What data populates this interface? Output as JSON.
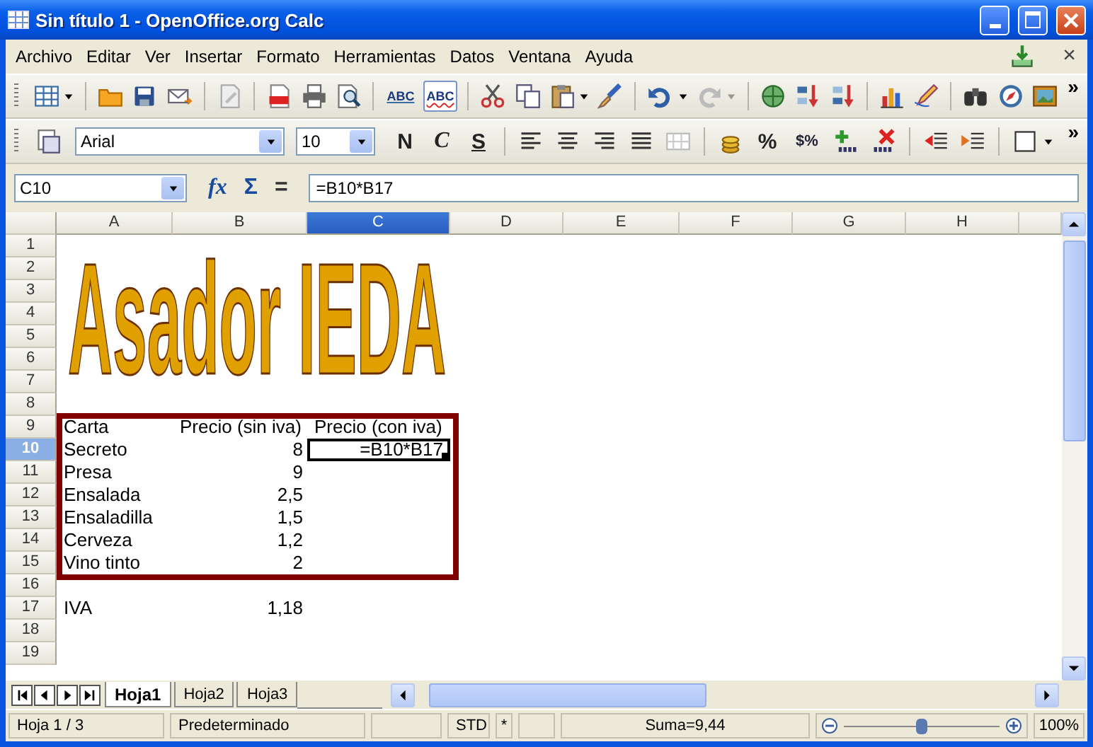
{
  "window": {
    "title": "Sin título 1 - OpenOffice.org Calc"
  },
  "menu": {
    "items": [
      "Archivo",
      "Editar",
      "Ver",
      "Insertar",
      "Formato",
      "Herramientas",
      "Datos",
      "Ventana",
      "Ayuda"
    ],
    "close": "×"
  },
  "toolbar_standard": {
    "spellcheck": "ABC",
    "autospell": "ABC",
    "autospell_on": true,
    "overflow": "»"
  },
  "toolbar_formatting": {
    "font": "Arial",
    "size": "10",
    "bold": "N",
    "italic": "C",
    "underline": "S",
    "percent": "%",
    "currency": "$%",
    "overflow": "»"
  },
  "formula_bar": {
    "name_box": "C10",
    "function_wizard": "fx",
    "sum": "Σ",
    "equals": "=",
    "formula": "=B10*B17"
  },
  "columns": [
    {
      "label": "A",
      "selected": false
    },
    {
      "label": "B",
      "selected": false
    },
    {
      "label": "C",
      "selected": true
    },
    {
      "label": "D",
      "selected": false
    },
    {
      "label": "E",
      "selected": false
    },
    {
      "label": "F",
      "selected": false
    },
    {
      "label": "G",
      "selected": false
    },
    {
      "label": "H",
      "selected": false
    }
  ],
  "word_art": "Asador IEDA",
  "rows": [
    {
      "header": "1",
      "selected": false
    },
    {
      "header": "2",
      "selected": false
    },
    {
      "header": "3",
      "selected": false
    },
    {
      "header": "4",
      "selected": false
    },
    {
      "header": "5",
      "selected": false
    },
    {
      "header": "6",
      "selected": false
    },
    {
      "header": "7",
      "selected": false
    },
    {
      "header": "8",
      "selected": false
    },
    {
      "header": "9",
      "selected": false,
      "kind": "heading",
      "a": "Carta",
      "b": "Precio (sin iva)",
      "c": "Precio (con iva)"
    },
    {
      "header": "10",
      "selected": true,
      "kind": "item",
      "a": "Secreto",
      "b": "8",
      "c": "=B10*B17"
    },
    {
      "header": "11",
      "selected": false,
      "kind": "item",
      "a": "Presa",
      "b": "9"
    },
    {
      "header": "12",
      "selected": false,
      "kind": "item",
      "a": "Ensalada",
      "b": "2,5"
    },
    {
      "header": "13",
      "selected": false,
      "kind": "item",
      "a": "Ensaladilla",
      "b": "1,5"
    },
    {
      "header": "14",
      "selected": false,
      "kind": "item",
      "a": "Cerveza",
      "b": "1,2"
    },
    {
      "header": "15",
      "selected": false,
      "kind": "item",
      "a": "Vino tinto",
      "b": "2"
    },
    {
      "header": "16",
      "selected": false
    },
    {
      "header": "17",
      "selected": false,
      "kind": "item",
      "a": "IVA",
      "b": "1,18"
    },
    {
      "header": "18",
      "selected": false
    },
    {
      "header": "19",
      "selected": false
    }
  ],
  "sheet_tabs": [
    {
      "label": "Hoja1",
      "selected": true
    },
    {
      "label": "Hoja2",
      "selected": false
    },
    {
      "label": "Hoja3",
      "selected": false
    }
  ],
  "status_bar": {
    "sheet": "Hoja 1 / 3",
    "style": "Predeterminado",
    "mode": "STD",
    "modified": "*",
    "sum": "Suma=9,44",
    "zoom": {
      "level": 0.5
    },
    "zoom_percent": "100%"
  }
}
